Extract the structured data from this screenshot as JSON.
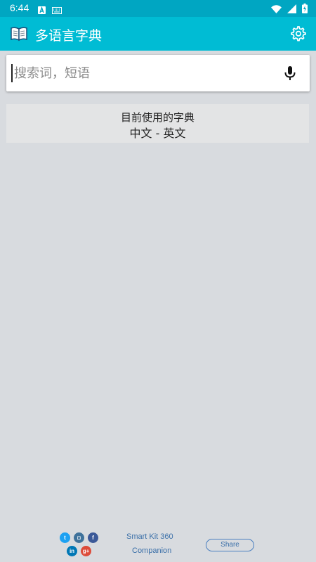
{
  "status_bar": {
    "time": "6:44",
    "left_icons": [
      "a-notification-icon",
      "keyboard-icon"
    ],
    "right_icons": [
      "wifi-icon",
      "signal-icon",
      "battery-charging-icon"
    ]
  },
  "app_bar": {
    "title": "多语言字典",
    "app_icon": "book-icon",
    "settings_icon": "gear-icon",
    "color": "#00bcd4",
    "status_color": "#00a6c2"
  },
  "search": {
    "placeholder": "搜索词，短语",
    "value": "",
    "mic_icon": "microphone-icon"
  },
  "current_dictionary": {
    "title": "目前使用的字典",
    "value": "中文 - 英文"
  },
  "footer": {
    "social": [
      {
        "name": "twitter",
        "glyph": "t",
        "color": "#1da1f2"
      },
      {
        "name": "instagram",
        "glyph": "◘",
        "color": "#3f729b"
      },
      {
        "name": "facebook",
        "glyph": "f",
        "color": "#3b5998"
      },
      {
        "name": "linkedin",
        "glyph": "in",
        "color": "#0077b5"
      },
      {
        "name": "google-plus",
        "glyph": "g+",
        "color": "#dd4b39"
      }
    ],
    "brand_line1": "Smart Kit 360",
    "brand_line2": "Companion",
    "share_label": "Share"
  }
}
